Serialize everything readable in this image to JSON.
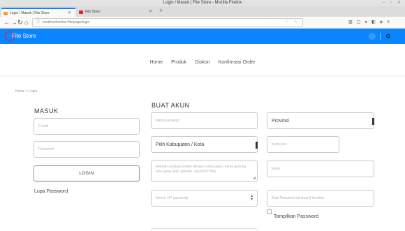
{
  "window": {
    "title": "Login / Masuk | Fite Store - Mozilla Firefox"
  },
  "tabs": [
    {
      "label": "Login / Masuk | Fite Store"
    },
    {
      "label": "Fite Store"
    }
  ],
  "navbar": {
    "url": "localhost/online-fite/page/login"
  },
  "header": {
    "brand": "Fite Store"
  },
  "nav": {
    "items": [
      "Home",
      "Produk",
      "Diskon",
      "Konfirmasi Order"
    ]
  },
  "breadcrumb": "Home  >  Login",
  "login": {
    "heading": "MASUK",
    "email_placeholder": "E-mail",
    "password_placeholder": "Password",
    "button": "LOGIN",
    "forgot": "Lupa Password"
  },
  "register": {
    "heading": "BUAT AKUN",
    "name_placeholder": "Nama Lengkap",
    "province": "Provinsi",
    "city": "Pilih Kabupaten / Kota",
    "postal_placeholder": "Kode pos",
    "address_placeholder": "Alamat Lengkap (isikan dengan nama jalan, nama gedung atau yang lebih spesifik, seperti RT/Rw",
    "email_placeholder": "Email",
    "phone_placeholder": "Nomor HP (opsional)",
    "password_placeholder": "Buat Password minimal 8 karakter",
    "show_password": "Tampilkan Password"
  },
  "colors": {
    "header": "#0a84ff",
    "brand_red": "#e0262b"
  }
}
